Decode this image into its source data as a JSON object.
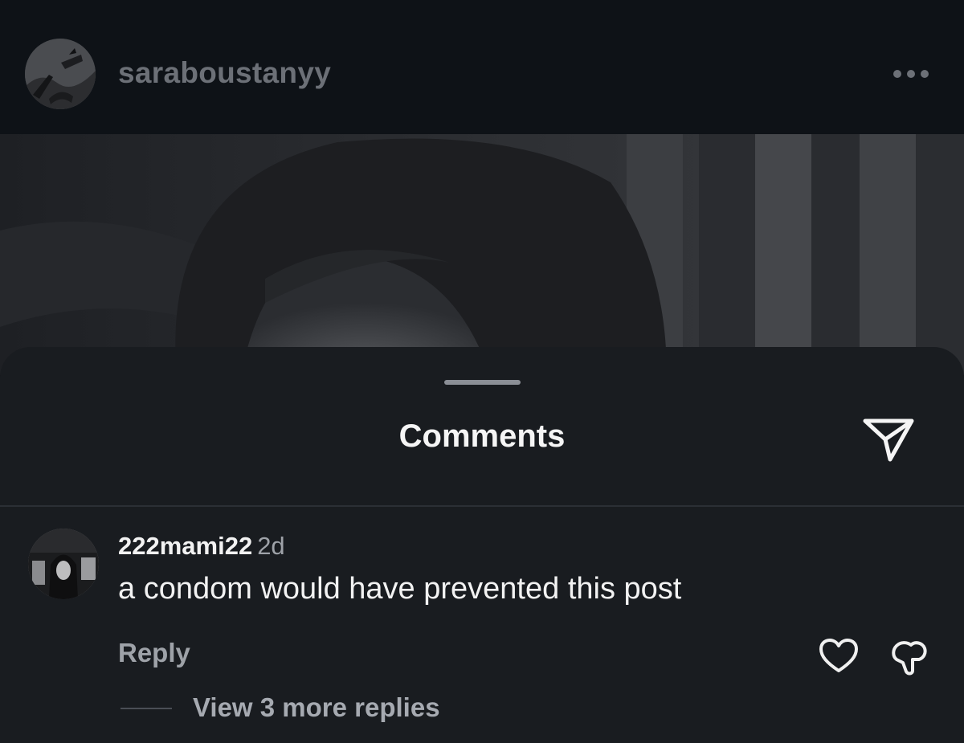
{
  "post": {
    "username": "saraboustanyy",
    "more_icon": "more-horizontal-icon"
  },
  "comments_sheet": {
    "title": "Comments",
    "share_icon": "send-icon"
  },
  "comment": {
    "username": "222mami22",
    "time": "2d",
    "text": "a condom would have prevented this post",
    "reply_label": "Reply",
    "like_icon": "heart-icon",
    "dislike_icon": "dislike-icon",
    "view_replies_label": "View 3 more replies"
  }
}
